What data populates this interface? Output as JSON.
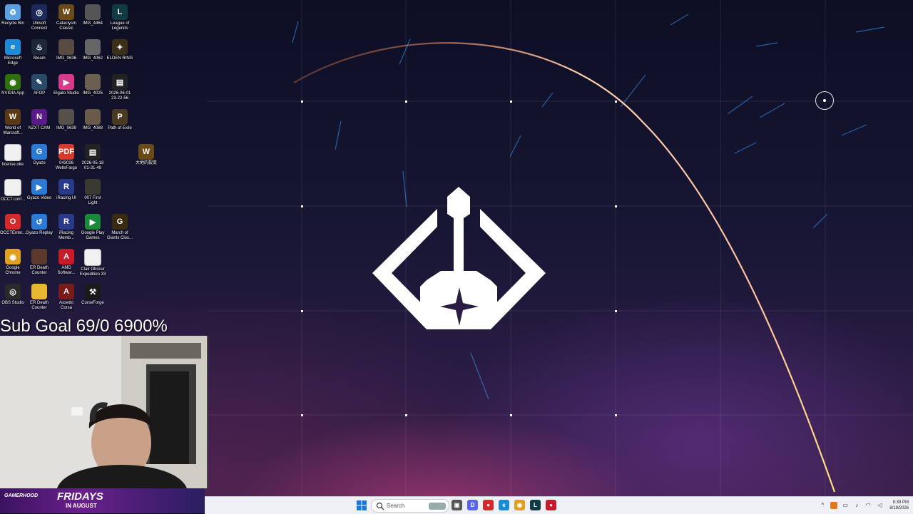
{
  "desktop": {
    "icons": [
      {
        "label": "Recycle Bin",
        "icon": "recycle-bin-icon",
        "color": "#5aa0e0",
        "glyph": "♻"
      },
      {
        "label": "Ubisoft\nConnect",
        "icon": "ubisoft-icon",
        "color": "#1b2a5a",
        "glyph": "◎"
      },
      {
        "label": "Cataclysm\nClassic",
        "icon": "wow-icon",
        "color": "#6b4a1a",
        "glyph": "W"
      },
      {
        "label": "IMG_4464",
        "icon": "image-thumb-icon",
        "color": "#555555",
        "glyph": ""
      },
      {
        "label": "League of\nLegends",
        "icon": "league-icon",
        "color": "#0f3b44",
        "glyph": "L"
      },
      {
        "label": "Microsoft\nEdge",
        "icon": "edge-icon",
        "color": "#1c8ad6",
        "glyph": "e"
      },
      {
        "label": "Steam",
        "icon": "steam-icon",
        "color": "#1b2838",
        "glyph": "♨"
      },
      {
        "label": "IMG_0636",
        "icon": "image-thumb-icon",
        "color": "#5a4a44",
        "glyph": ""
      },
      {
        "label": "IMG_4062",
        "icon": "image-thumb-icon",
        "color": "#666666",
        "glyph": ""
      },
      {
        "label": "ELDEN RING",
        "icon": "elden-ring-icon",
        "color": "#3a3018",
        "glyph": "✦"
      },
      {
        "label": "NVIDIA App",
        "icon": "nvidia-icon",
        "color": "#2f6f0e",
        "glyph": "◉"
      },
      {
        "label": "AFOP",
        "icon": "afop-icon",
        "color": "#2a4a6a",
        "glyph": "✎"
      },
      {
        "label": "Elgato Studio",
        "icon": "elgato-icon",
        "color": "#d63a8a",
        "glyph": "▶"
      },
      {
        "label": "IMG_4025",
        "icon": "image-thumb-icon",
        "color": "#6a6052",
        "glyph": ""
      },
      {
        "label": "2026-06-01\n23-22-56",
        "icon": "video-file-icon",
        "color": "#222222",
        "glyph": "▤"
      },
      {
        "label": "World of\nWarcraft...",
        "icon": "wow-icon",
        "color": "#5a3a12",
        "glyph": "W"
      },
      {
        "label": "NZXT CAM",
        "icon": "nzxt-icon",
        "color": "#5a1a8a",
        "glyph": "N"
      },
      {
        "label": "IMG_0639",
        "icon": "image-thumb-icon",
        "color": "#55504a",
        "glyph": ""
      },
      {
        "label": "IMG_4088",
        "icon": "image-thumb-icon",
        "color": "#6a5a4a",
        "glyph": ""
      },
      {
        "label": "Path of Exile",
        "icon": "path-of-exile-icon",
        "color": "#4a3a20",
        "glyph": "P"
      },
      {
        "label": "license.oke",
        "icon": "file-icon",
        "color": "#f0f0f0",
        "glyph": ""
      },
      {
        "label": "Gyazo",
        "icon": "gyazo-icon",
        "color": "#2a7ad6",
        "glyph": "G"
      },
      {
        "label": "043026\nWellsFargo",
        "icon": "pdf-icon",
        "color": "#d63a2a",
        "glyph": "PDF"
      },
      {
        "label": "2026-05-18\n01-31-49",
        "icon": "video-file-icon",
        "color": "#222222",
        "glyph": "▤"
      },
      {
        "label": "大地的裂变",
        "icon": "wow-icon",
        "color": "#6b4a1a",
        "glyph": "W"
      },
      {
        "label": "OCCT.conf...",
        "icon": "file-icon",
        "color": "#f0f0f0",
        "glyph": ""
      },
      {
        "label": "Gyazo Video",
        "icon": "gyazo-video-icon",
        "color": "#2a7ad6",
        "glyph": "▶"
      },
      {
        "label": "iRacing UI",
        "icon": "iracing-icon",
        "color": "#2a3a8a",
        "glyph": "R"
      },
      {
        "label": "007 First\nLight",
        "icon": "game-007-icon",
        "color": "#3a3a30",
        "glyph": ""
      },
      {
        "label": "OCCTEnter...",
        "icon": "occt-icon",
        "color": "#d62a2a",
        "glyph": "O"
      },
      {
        "label": "Gyazo Replay",
        "icon": "gyazo-replay-icon",
        "color": "#2a7ad6",
        "glyph": "↺"
      },
      {
        "label": "iRacing\nMemb...",
        "icon": "iracing-icon",
        "color": "#2a3a8a",
        "glyph": "R"
      },
      {
        "label": "Google Play\nGames",
        "icon": "google-play-icon",
        "color": "#1a8a3a",
        "glyph": "▶"
      },
      {
        "label": "March of\nGiants Clos...",
        "icon": "march-of-giants-icon",
        "color": "#3a2a10",
        "glyph": "G"
      },
      {
        "label": "Google\nChrome",
        "icon": "chrome-icon",
        "color": "#e0a020",
        "glyph": "◉"
      },
      {
        "label": "ER Death\nCounter",
        "icon": "er-counter-icon",
        "color": "#5a3a2a",
        "glyph": ""
      },
      {
        "label": "AMD\nSoftwar...",
        "icon": "amd-icon",
        "color": "#c81a2a",
        "glyph": "A"
      },
      {
        "label": "Clair Obscur\nExpedition 33",
        "icon": "file-icon",
        "color": "#f0f0f0",
        "glyph": ""
      },
      {
        "label": "OBS Studio",
        "icon": "obs-icon",
        "color": "#2a2a2a",
        "glyph": "◎"
      },
      {
        "label": "ER Death\nCounter",
        "icon": "folder-icon",
        "color": "#e8b830",
        "glyph": ""
      },
      {
        "label": "Assetto\nCorsa",
        "icon": "assetto-corsa-icon",
        "color": "#7a1a1a",
        "glyph": "A"
      },
      {
        "label": "CurseForge",
        "icon": "curseforge-icon",
        "color": "#1a1a1a",
        "glyph": "⚒"
      }
    ]
  },
  "overlay": {
    "sub_goal": "Sub Goal 69/0 6900%"
  },
  "banner": {
    "brand": "GAMERHOOD",
    "title": "FRIDAYS",
    "sub": "IN AUGUST"
  },
  "taskbar": {
    "search_placeholder": "Search",
    "apps": [
      {
        "icon": "task-view-icon",
        "color": "#555555",
        "glyph": "▣"
      },
      {
        "icon": "discord-icon",
        "color": "#5865f2",
        "glyph": "D"
      },
      {
        "icon": "record-icon",
        "color": "#d62a2a",
        "glyph": "●"
      },
      {
        "icon": "edge-icon",
        "color": "#1c8ad6",
        "glyph": "e"
      },
      {
        "icon": "chrome-icon",
        "color": "#e0a020",
        "glyph": "◉"
      },
      {
        "icon": "league-icon",
        "color": "#0f3b44",
        "glyph": "L"
      },
      {
        "icon": "app-icon",
        "color": "#c81a2a",
        "glyph": "●"
      }
    ],
    "clock_time": "8:39 PM",
    "clock_date": "8/19/2026"
  }
}
